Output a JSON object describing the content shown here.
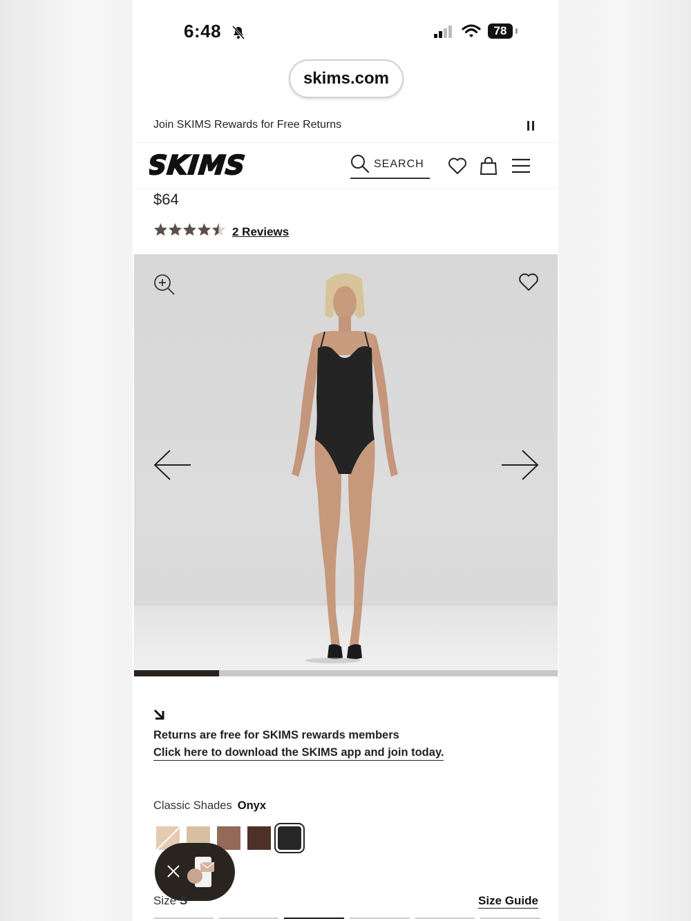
{
  "status_bar": {
    "time": "6:48",
    "battery": "78"
  },
  "browser": {
    "url": "skims.com"
  },
  "promo": {
    "text": "Join SKIMS Rewards for Free Returns"
  },
  "nav": {
    "logo": "SKIMS",
    "search_label": "SEARCH"
  },
  "product": {
    "price": "$64",
    "rating": 4.5,
    "reviews_label": "2 Reviews"
  },
  "gallery": {
    "progress": 0.2
  },
  "returns": {
    "line1": "Returns are free for SKIMS rewards members",
    "line2": "Click here to download the SKIMS app and join today."
  },
  "shades": {
    "label": "Classic Shades",
    "selected": "Onyx",
    "colors": [
      "#e4cbb1",
      "#d9bfa1",
      "#93695a",
      "#4d3128",
      "#262626"
    ]
  },
  "size": {
    "label": "Size",
    "selected": "S",
    "guide_label": "Size Guide"
  }
}
